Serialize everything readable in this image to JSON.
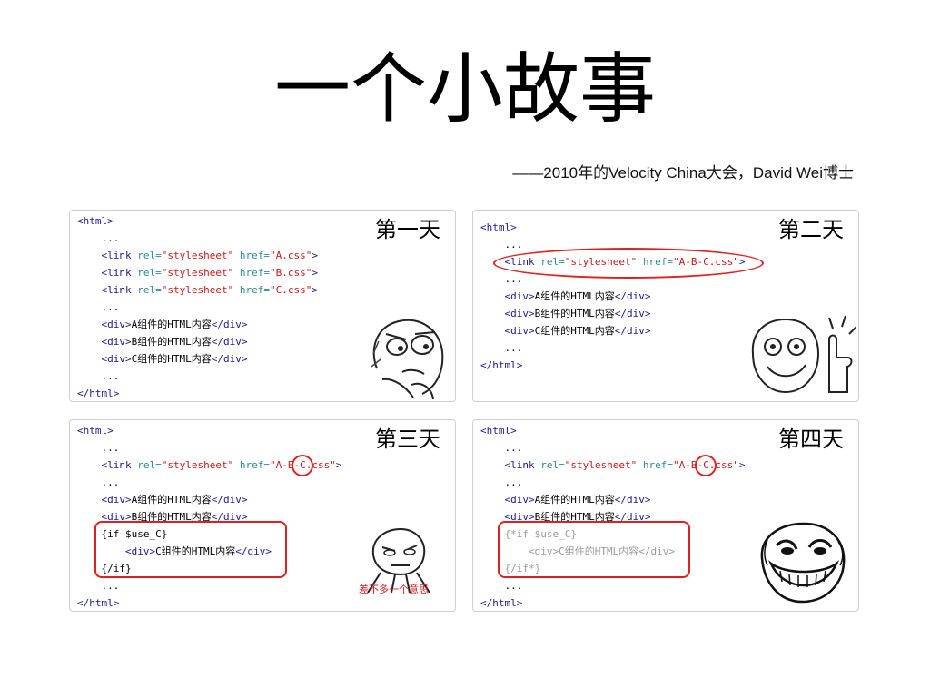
{
  "title": "一个小故事",
  "subtitle": "——2010年的Velocity China大会，David Wei博士",
  "panels": [
    {
      "day": "第一天",
      "lines": [
        {
          "indent": 0,
          "text": "<html>",
          "kind": "tag"
        },
        {
          "indent": 1,
          "text": "...",
          "kind": "plain"
        },
        {
          "indent": 1,
          "text": "<link rel=\"stylesheet\" href=\"A.css\">",
          "kind": "link"
        },
        {
          "indent": 1,
          "text": "<link rel=\"stylesheet\" href=\"B.css\">",
          "kind": "link"
        },
        {
          "indent": 1,
          "text": "<link rel=\"stylesheet\" href=\"C.css\">",
          "kind": "link"
        },
        {
          "indent": 1,
          "text": "...",
          "kind": "plain"
        },
        {
          "indent": 1,
          "text": "<div>A组件的HTML内容</div>",
          "kind": "tag"
        },
        {
          "indent": 1,
          "text": "<div>B组件的HTML内容</div>",
          "kind": "tag"
        },
        {
          "indent": 1,
          "text": "<div>C组件的HTML内容</div>",
          "kind": "tag"
        },
        {
          "indent": 1,
          "text": "...",
          "kind": "plain"
        },
        {
          "indent": 0,
          "text": "</html>",
          "kind": "tag"
        }
      ]
    },
    {
      "day": "第二天",
      "lines": [
        {
          "indent": 0,
          "text": "<html>",
          "kind": "tag"
        },
        {
          "indent": 1,
          "text": "...",
          "kind": "plain"
        },
        {
          "indent": 1,
          "text": "<link rel=\"stylesheet\" href=\"A-B-C.css\">",
          "kind": "link"
        },
        {
          "indent": 1,
          "text": "...",
          "kind": "plain"
        },
        {
          "indent": 1,
          "text": "<div>A组件的HTML内容</div>",
          "kind": "tag"
        },
        {
          "indent": 1,
          "text": "<div>B组件的HTML内容</div>",
          "kind": "tag"
        },
        {
          "indent": 1,
          "text": "<div>C组件的HTML内容</div>",
          "kind": "tag"
        },
        {
          "indent": 1,
          "text": "...",
          "kind": "plain"
        },
        {
          "indent": 0,
          "text": "</html>",
          "kind": "tag"
        }
      ]
    },
    {
      "day": "第三天",
      "caption": "差不多一个意思",
      "lines": [
        {
          "indent": 0,
          "text": "<html>",
          "kind": "tag"
        },
        {
          "indent": 1,
          "text": "...",
          "kind": "plain"
        },
        {
          "indent": 1,
          "text": "<link rel=\"stylesheet\" href=\"A-B-C.css\">",
          "kind": "link"
        },
        {
          "indent": 1,
          "text": "...",
          "kind": "plain"
        },
        {
          "indent": 1,
          "text": "<div>A组件的HTML内容</div>",
          "kind": "tag"
        },
        {
          "indent": 1,
          "text": "<div>B组件的HTML内容</div>",
          "kind": "tag"
        },
        {
          "indent": 1,
          "text": "{if $use_C}",
          "kind": "plain"
        },
        {
          "indent": 2,
          "text": "<div>C组件的HTML内容</div>",
          "kind": "tag"
        },
        {
          "indent": 1,
          "text": "{/if}",
          "kind": "plain"
        },
        {
          "indent": 1,
          "text": "...",
          "kind": "plain"
        },
        {
          "indent": 0,
          "text": "</html>",
          "kind": "tag"
        }
      ]
    },
    {
      "day": "第四天",
      "lines": [
        {
          "indent": 0,
          "text": "<html>",
          "kind": "tag"
        },
        {
          "indent": 1,
          "text": "...",
          "kind": "plain"
        },
        {
          "indent": 1,
          "text": "<link rel=\"stylesheet\" href=\"A-B-C.css\">",
          "kind": "link"
        },
        {
          "indent": 1,
          "text": "...",
          "kind": "plain"
        },
        {
          "indent": 1,
          "text": "<div>A组件的HTML内容</div>",
          "kind": "tag"
        },
        {
          "indent": 1,
          "text": "<div>B组件的HTML内容</div>",
          "kind": "tag"
        },
        {
          "indent": 1,
          "text": "{*if $use_C}",
          "kind": "gray"
        },
        {
          "indent": 2,
          "text": "<div>C组件的HTML内容</div>",
          "kind": "gray"
        },
        {
          "indent": 1,
          "text": "{/if*}",
          "kind": "gray"
        },
        {
          "indent": 1,
          "text": "...",
          "kind": "plain"
        },
        {
          "indent": 0,
          "text": "</html>",
          "kind": "tag"
        }
      ]
    }
  ],
  "colors": {
    "tag": "#1a1a8c",
    "attr": "#2c8a8a",
    "string": "#c41a16",
    "highlight": "#e02020",
    "comment": "#9a9a9a"
  },
  "icons": [
    "thinking-meme-face-icon",
    "thumbs-up-meme-face-icon",
    "skeptical-meme-face-icon",
    "troll-face-icon"
  ]
}
